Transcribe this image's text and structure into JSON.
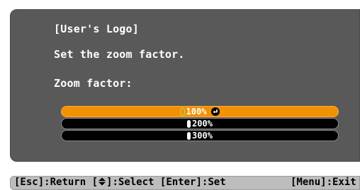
{
  "dialog": {
    "title": "[User's Logo]",
    "instruction": "Set the zoom factor.",
    "label": "Zoom factor:"
  },
  "options": [
    {
      "label": "100%",
      "selected": true
    },
    {
      "label": "200%",
      "selected": false
    },
    {
      "label": "300%",
      "selected": false
    }
  ],
  "footer": {
    "esc_key": "[Esc]",
    "esc_action": ":Return ",
    "select_open": "[",
    "select_action": "]:Select ",
    "enter_key": "[Enter]",
    "enter_action": ":Set",
    "menu_key": "[Menu]",
    "menu_action": ":Exit"
  },
  "colors": {
    "panel": "#595959",
    "selected": "#f39100",
    "footer": "#bdbdbd"
  },
  "icons": [
    "enter-icon",
    "up-down-arrow-icon"
  ]
}
